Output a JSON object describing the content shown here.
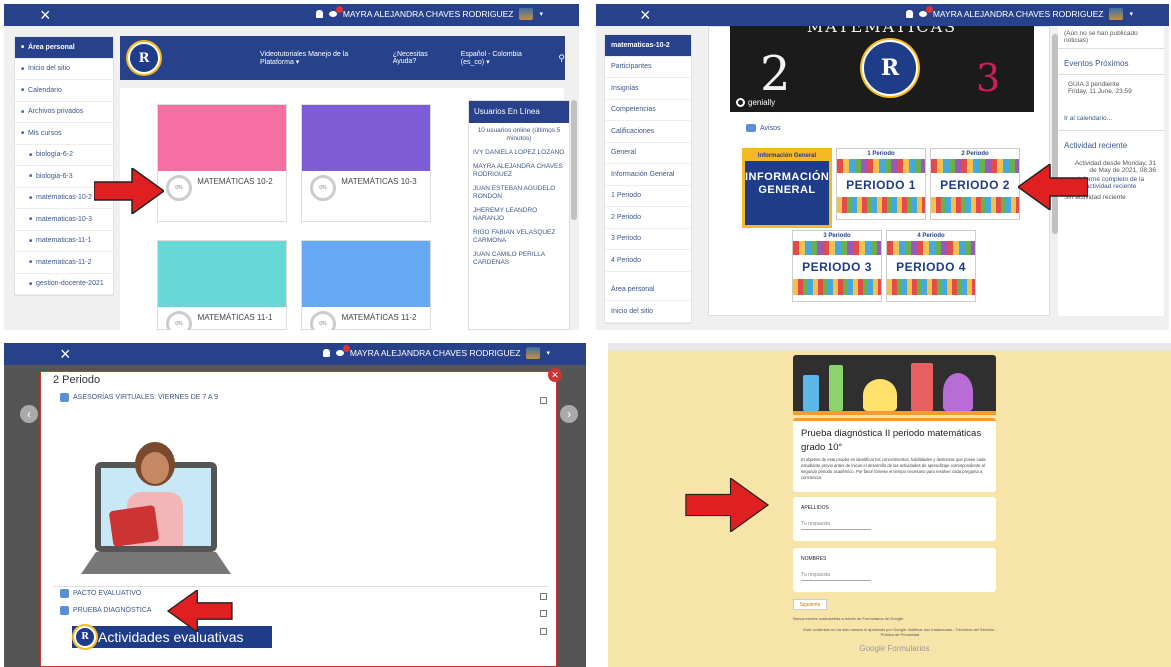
{
  "panel1": {
    "close": "×",
    "user_name": "MAYRA ALEJANDRA CHAVES RODRIGUEZ",
    "caret": "▾",
    "sidebar": [
      {
        "label": "Área personal",
        "icon": "dashboard-icon",
        "active": true
      },
      {
        "label": "Inicio del sitio",
        "icon": "home-icon"
      },
      {
        "label": "Calendario",
        "icon": "calendar-icon"
      },
      {
        "label": "Archivos privados",
        "icon": "file-icon"
      },
      {
        "label": "Mis cursos",
        "icon": "graduation-cap-icon"
      },
      {
        "label": "biología-6-2",
        "icon": "graduation-cap-icon",
        "sub": true
      },
      {
        "label": "biologia-6-3",
        "icon": "graduation-cap-icon",
        "sub": true
      },
      {
        "label": "matematicas-10-2",
        "icon": "graduation-cap-icon",
        "sub": true
      },
      {
        "label": "matematicas-10-3",
        "icon": "graduation-cap-icon",
        "sub": true
      },
      {
        "label": "matematicas-11-1",
        "icon": "graduation-cap-icon",
        "sub": true
      },
      {
        "label": "matematicas-11-2",
        "icon": "graduation-cap-icon",
        "sub": true
      },
      {
        "label": "gestion-docente-2021",
        "icon": "graduation-cap-icon",
        "sub": true
      }
    ],
    "header_links": [
      "Videotutoriales Manejo de la Plataforma ▾",
      "¿Necesitas Ayuda?",
      "Español - Colombia (es_co) ▾"
    ],
    "courses": [
      {
        "title": "MATEMÁTICAS 10-2",
        "color": "#f66fa3"
      },
      {
        "title": "MATEMÁTICAS 10-3",
        "color": "#7d5cd6"
      },
      {
        "title": "MATEMÁTICAS 11-1",
        "color": "#66d9d6"
      },
      {
        "title": "MATEMÁTICAS 11-2",
        "color": "#64a9f2"
      }
    ],
    "pct": "0%",
    "online_title": "Usuarios En Línea",
    "online_users": [
      "10 usuarios online (últimos 5 minutos)",
      "IVY DANIELA LOPEZ LOZANO",
      "MAYRA ALEJANDRA CHAVES RODRIGUEZ",
      "JUAN ESTEBAN AGUDELO RONDON",
      "JHEREMY LEANDRO NARANJO",
      "RIGO FABIAN VELASQUEZ CARMONA",
      "JUAN CAMILO PERILLA CARDENAS"
    ]
  },
  "panel2": {
    "user_name": "MAYRA ALEJANDRA CHAVES RODRIGUEZ",
    "banner_title": "MATEMÁTICAS",
    "genially": "genially",
    "sidebar": [
      {
        "label": "matematicas-10-2",
        "active": true
      },
      {
        "label": "Participantes"
      },
      {
        "label": "Insignias"
      },
      {
        "label": "Competencias"
      },
      {
        "label": "Calificaciones"
      },
      {
        "label": "General"
      },
      {
        "label": "Información General"
      },
      {
        "label": "1 Periodo"
      },
      {
        "label": "2 Periodo"
      },
      {
        "label": "3 Periodo"
      },
      {
        "label": "4 Periodo"
      },
      {
        "label": "Área personal"
      },
      {
        "label": "Inicio del sitio"
      }
    ],
    "avisos": "Avisos",
    "period_cards": [
      {
        "label": "Información General",
        "text": "INFORMACIÓN GENERAL"
      },
      {
        "label": "1 Periodo",
        "text": "PERIODO 1"
      },
      {
        "label": "2 Periodo",
        "text": "PERIODO 2"
      },
      {
        "label": "3 Periodo",
        "text": "PERIODO 3"
      },
      {
        "label": "4 Periodo",
        "text": "PERIODO 4"
      }
    ],
    "right": {
      "news_note": "(Aún no se han publicado noticias)",
      "events_title": "Eventos Próximos",
      "event_name": "GUIA 3 pendiente",
      "event_date": "Friday, 11 June, 23:59",
      "calendar_link": "Ir al calendario...",
      "recent_title": "Actividad reciente",
      "recent_since": "Actividad desde Monday, 31 de May de 2021, 08:36",
      "recent_report": "Informe completo de la actividad reciente",
      "recent_none": "Sin actividad reciente"
    }
  },
  "panel3": {
    "user_name": "MAYRA ALEJANDRA CHAVES RODRIGUEZ",
    "section_title": "2 Periodo",
    "activities": [
      "ASESORÍAS VIRTUALES: VIERNES DE 7 A 9",
      "PACTO EVALUATIVO",
      "PRUEBA DIAGNÓSTICA"
    ],
    "footer_banner": "Actividades evaluativas"
  },
  "panel4": {
    "form_title": "Prueba diagnóstica II periodo matemáticas grado 10°",
    "form_desc": "El objetivo de esta prueba es identificar los conocimientos, habilidades y destrezas que posee cada estudiante previo antes de iniciar el desarrollo de las actividades de aprendizaje correspondiente al segundo periodo académico. Por favor tómese el tiempo necesario para resolver cada pregunta a conciencia.",
    "field1": "APELLIDOS",
    "field2": "NOMBRES",
    "placeholder": "Tu respuesta",
    "next": "Siguiente",
    "never_submit": "Nunca envíes contraseñas a través de Formularios de Google.",
    "disclaimer": "Este contenido no ha sido creado ni aprobado por Google. Notificar uso inadecuado - Términos del Servicio - Política de Privacidad",
    "brand": "Google Formularios"
  }
}
